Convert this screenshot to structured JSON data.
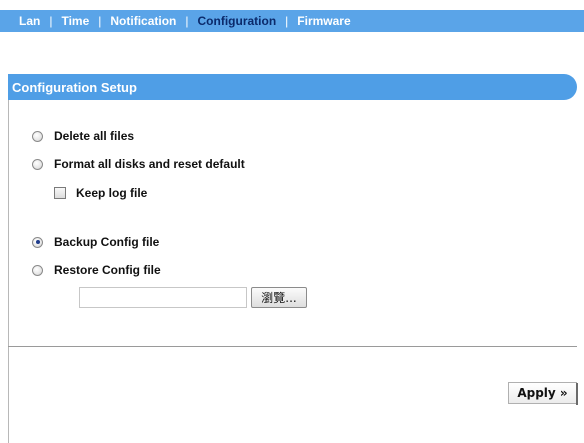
{
  "tabs": [
    {
      "label": "Lan"
    },
    {
      "label": "Time"
    },
    {
      "label": "Notification"
    },
    {
      "label": "Configuration",
      "active": true
    },
    {
      "label": "Firmware"
    }
  ],
  "separator": "|",
  "section": {
    "title": "Configuration Setup"
  },
  "options": {
    "delete_all": {
      "label": "Delete all files",
      "checked": false
    },
    "format_reset": {
      "label": "Format all disks and reset default",
      "checked": false
    },
    "keep_log": {
      "label": "Keep log file",
      "checked": false
    },
    "backup": {
      "label": "Backup Config file",
      "checked": true
    },
    "restore": {
      "label": "Restore Config file",
      "checked": false
    }
  },
  "file": {
    "value": "",
    "browse_label": "瀏覽..."
  },
  "apply_label": "Apply »",
  "colors": {
    "tab_bar": "#5aa4e8",
    "header": "#4f9ee6",
    "active_tab": "#0b2a6b"
  }
}
